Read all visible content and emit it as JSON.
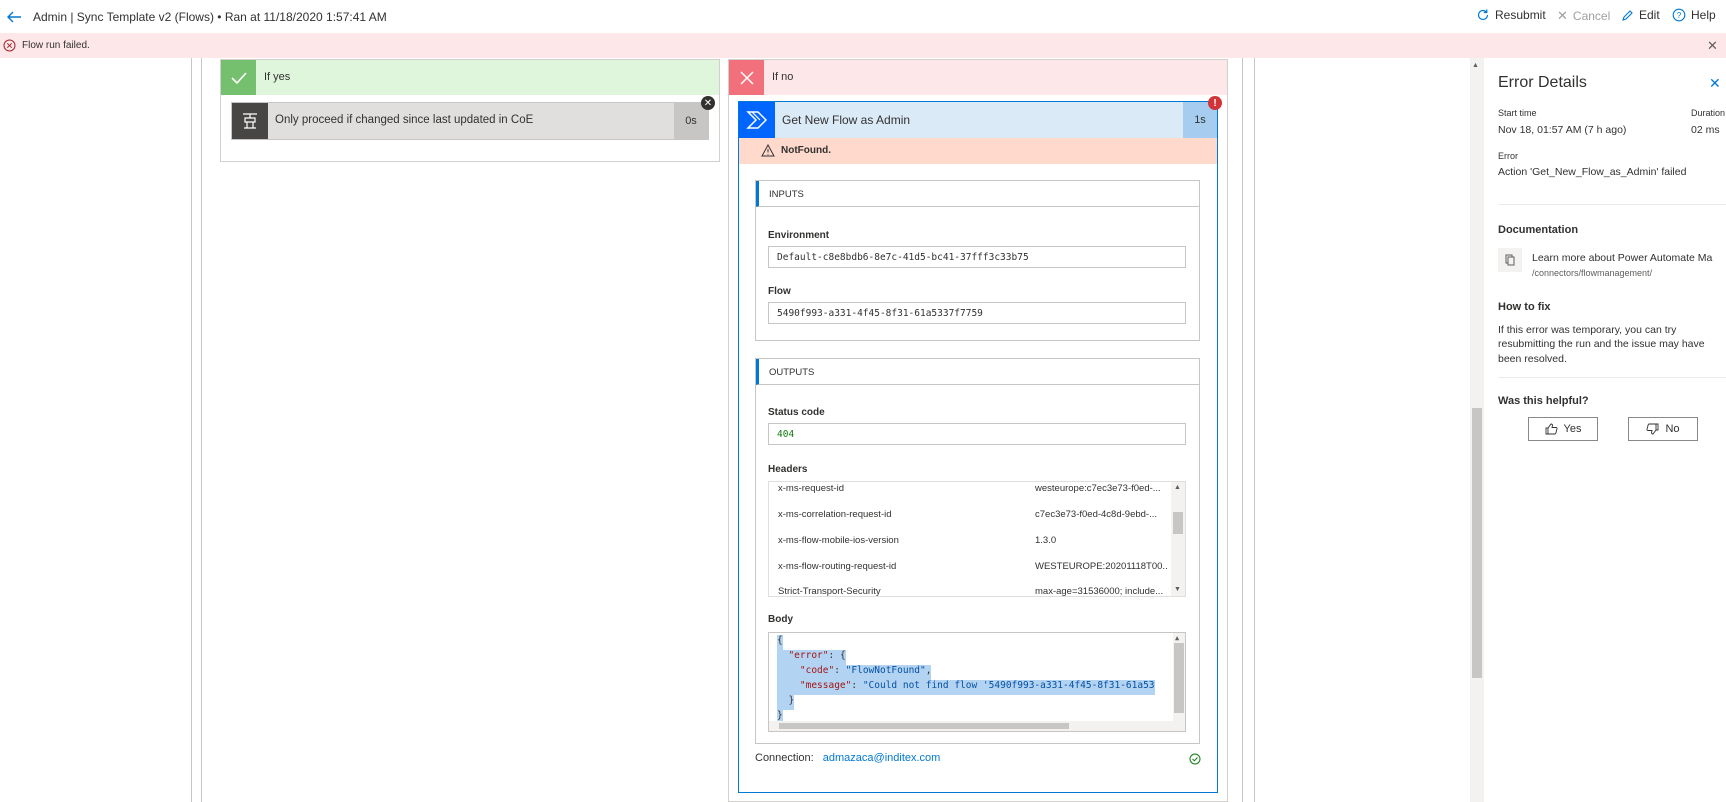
{
  "header": {
    "title": "Admin | Sync Template v2 (Flows) • Ran at 11/18/2020 1:57:41 AM",
    "commands": {
      "resubmit": "Resubmit",
      "cancel": "Cancel",
      "edit": "Edit",
      "help": "Help"
    }
  },
  "banner": {
    "text": "Flow run failed."
  },
  "if_yes": {
    "label": "If yes",
    "condition": {
      "label": "Only proceed if changed since last updated in CoE",
      "duration": "0s"
    }
  },
  "if_no": {
    "label": "If no",
    "action": {
      "title": "Get New Flow as Admin",
      "duration": "1s",
      "error_badge": "!",
      "error": "NotFound.",
      "inputs": {
        "heading": "INPUTS",
        "environment_label": "Environment",
        "environment_value": "Default-c8e8bdb6-8e7c-41d5-bc41-37fff3c33b75",
        "flow_label": "Flow",
        "flow_value": "5490f993-a331-4f45-8f31-61a5337f7759"
      },
      "outputs": {
        "heading": "OUTPUTS",
        "status_label": "Status code",
        "status_value": "404",
        "headers_label": "Headers",
        "headers": [
          {
            "key": "x-ms-request-id",
            "value": "westeurope:c7ec3e73-f0ed-..."
          },
          {
            "key": "x-ms-correlation-request-id",
            "value": "c7ec3e73-f0ed-4c8d-9ebd-..."
          },
          {
            "key": "x-ms-flow-mobile-ios-version",
            "value": "1.3.0"
          },
          {
            "key": "x-ms-flow-routing-request-id",
            "value": "WESTEUROPE:20201118T00..."
          },
          {
            "key": "Strict-Transport-Security",
            "value": "max-age=31536000; include..."
          }
        ],
        "body_label": "Body",
        "body": {
          "line1": "{",
          "error_key": "\"error\"",
          "code_key": "\"code\"",
          "code_value": "\"FlowNotFound\"",
          "message_key": "\"message\"",
          "message_value": "\"Could not find flow '5490f993-a331-4f45-8f31-61a53",
          "close_inner": "}",
          "close_outer": "}"
        }
      },
      "connection_label": "Connection:",
      "connection_value": "admazaca@inditex.com"
    }
  },
  "error_panel": {
    "title": "Error Details",
    "start_time_label": "Start time",
    "start_time_value": "Nov 18, 01:57 AM (7 h ago)",
    "duration_label": "Duration",
    "duration_value": "02 ms",
    "error_label": "Error",
    "error_value": "Action 'Get_New_Flow_as_Admin' failed",
    "documentation_heading": "Documentation",
    "doc_link_title": "Learn more about Power Automate Ma",
    "doc_link_path": "/connectors/flowmanagement/",
    "how_to_fix_heading": "How to fix",
    "how_to_fix_text_1": "If this error was temporary, you can try",
    "how_to_fix_text_2": "resubmitting the run and the issue may have",
    "how_to_fix_text_3": "been resolved.",
    "helpful_heading": "Was this helpful?",
    "yes_label": "Yes",
    "no_label": "No"
  },
  "colors": {
    "success_green": "#75c06f",
    "fail_red": "#f1707b",
    "accent_blue": "#0078d4",
    "error_banner": "#fde7e9"
  }
}
